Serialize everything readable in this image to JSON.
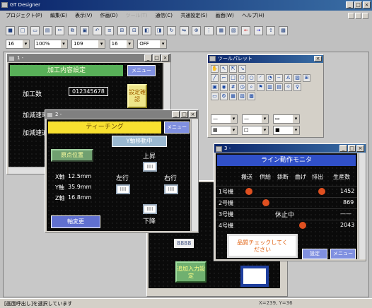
{
  "app": {
    "title": "GT Designer"
  },
  "menu": [
    "プロジェクト(P)",
    "編集(E)",
    "表示(V)",
    "作画(D)",
    "ツール(T)",
    "通信(C)",
    "共通設定(S)",
    "画面(W)",
    "ヘルプ(H)"
  ],
  "toolbar2": {
    "combo1": "16",
    "combo2": "100%",
    "combo3": "109",
    "combo4": "16",
    "combo5": "OFF"
  },
  "win1": {
    "title": "1 -",
    "header": "加工内容設定",
    "menu_btn": "メニュー",
    "row1": "加工数",
    "row1_value": "012345678",
    "row2": "加減速時間",
    "row3": "加減速適用",
    "side_btn": "設定確認"
  },
  "win2": {
    "title": "2 -",
    "header": "ティーチング",
    "menu_btn": "メニュー",
    "status": "Y軸移動中",
    "origin_btn": "原点位置",
    "x_label": "X軸",
    "x_val": "12.5mm",
    "y_label": "Y軸",
    "y_val": "35.9mm",
    "z_label": "Z軸",
    "z_val": "16.8mm",
    "up": "上昇",
    "left": "左行",
    "right": "右行",
    "down": "下降",
    "bottom_btn": "軸変更",
    "num": "8888"
  },
  "win3": {
    "title": "3 -",
    "header": "ライン動作モニタ",
    "cols": [
      "搬送",
      "供給",
      "鋲断",
      "曲げ",
      "排出",
      "生産数"
    ],
    "rows": [
      {
        "label": "1号機",
        "value": "1452"
      },
      {
        "label": "2号機",
        "value": "869"
      },
      {
        "label": "3号機",
        "value": "——",
        "note": "休止中"
      },
      {
        "label": "4号機",
        "value": "2043"
      }
    ],
    "notice": "品質チェックしてください",
    "btn1": "設定",
    "btn2": "メニュー"
  },
  "win4": {
    "num": "8888",
    "btn": "追加入力設定"
  },
  "palette": {
    "title": "ツールパレット"
  },
  "status": {
    "text": "[画面呼出し]を選択しています",
    "coords": "X=239, Y=36"
  }
}
